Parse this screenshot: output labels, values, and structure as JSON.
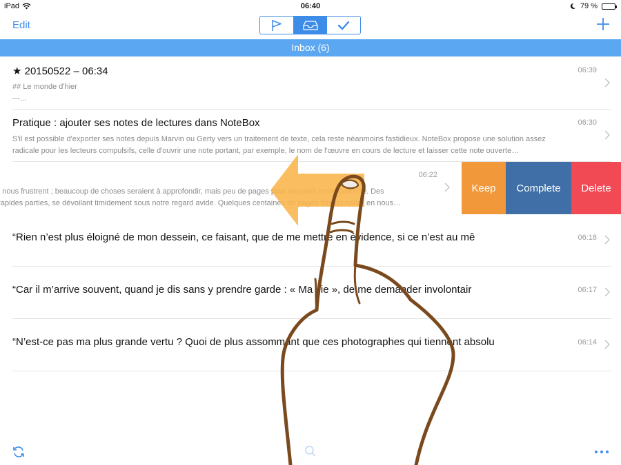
{
  "status_bar": {
    "device": "iPad",
    "time": "06:40",
    "battery": "79 %",
    "battery_level": 0.79
  },
  "nav": {
    "edit_label": "Edit",
    "segments": [
      {
        "icon": "flag-icon",
        "selected": false
      },
      {
        "icon": "inbox-tray-icon",
        "selected": true
      },
      {
        "icon": "checkmark-icon",
        "selected": false
      }
    ],
    "add_icon": "plus-icon"
  },
  "inbox": {
    "title": "Inbox (6)"
  },
  "notes": [
    {
      "title": "★ 20150522 – 06:34",
      "time": "06:39",
      "preview": [
        "## Le monde d'hier",
        "---..."
      ]
    },
    {
      "title": "Pratique : ajouter ses notes de lectures dans NoteBox",
      "time": "06:30",
      "preview": [
        "S'il est possible d'exporter ses notes depuis Marvin ou Gerty vers un traitement de texte, cela reste néanmoins fastidieux. NoteBox propose une solution assez",
        "radicale pour les lecteurs compulsifs, celle d'ouvrir une note portant, par exemple, le nom de l'œuvre en cours de lecture et laisser cette note ouverte…"
      ]
    },
    {
      "title": "",
      "time": "06:22",
      "preview": [
        "ge nous frustrent ; beaucoup de choses seraient à approfondir, mais peu de pages pour assouvir notre curiosité. Des",
        "p rapides parties, se dévoilant timidement sous notre regard avide. Quelques centaines de pages faisant naître en nous…"
      ],
      "swiped": true
    },
    {
      "title": "“Rien n’est plus éloigné de mon dessein, ce faisant, que de me mettre en évidence, si ce n’est au mê",
      "time": "06:18"
    },
    {
      "title": "“Car il m’arrive souvent, quand je dis sans y prendre garde : « Ma vie », de me demander involontair",
      "time": "06:17"
    },
    {
      "title": "“N’est-ce pas ma plus grande vertu ? Quoi de plus assommant que ces photographes qui tiennent absolu",
      "time": "06:14"
    }
  ],
  "swipe_actions": {
    "keep": "Keep",
    "complete": "Complete",
    "delete": "Delete"
  },
  "toolbar": {
    "left_icon": "sync-icon",
    "center_icon": "search-icon",
    "right_icon": "more-icon"
  },
  "colors": {
    "accent": "#3d8ce8",
    "header_bar": "#5ca7f1",
    "keep": "#f0983a",
    "complete": "#3f6fa6",
    "delete": "#f24a55",
    "swipe_arrow": "#f9b54a",
    "finger_outline": "#7a4a1e"
  }
}
